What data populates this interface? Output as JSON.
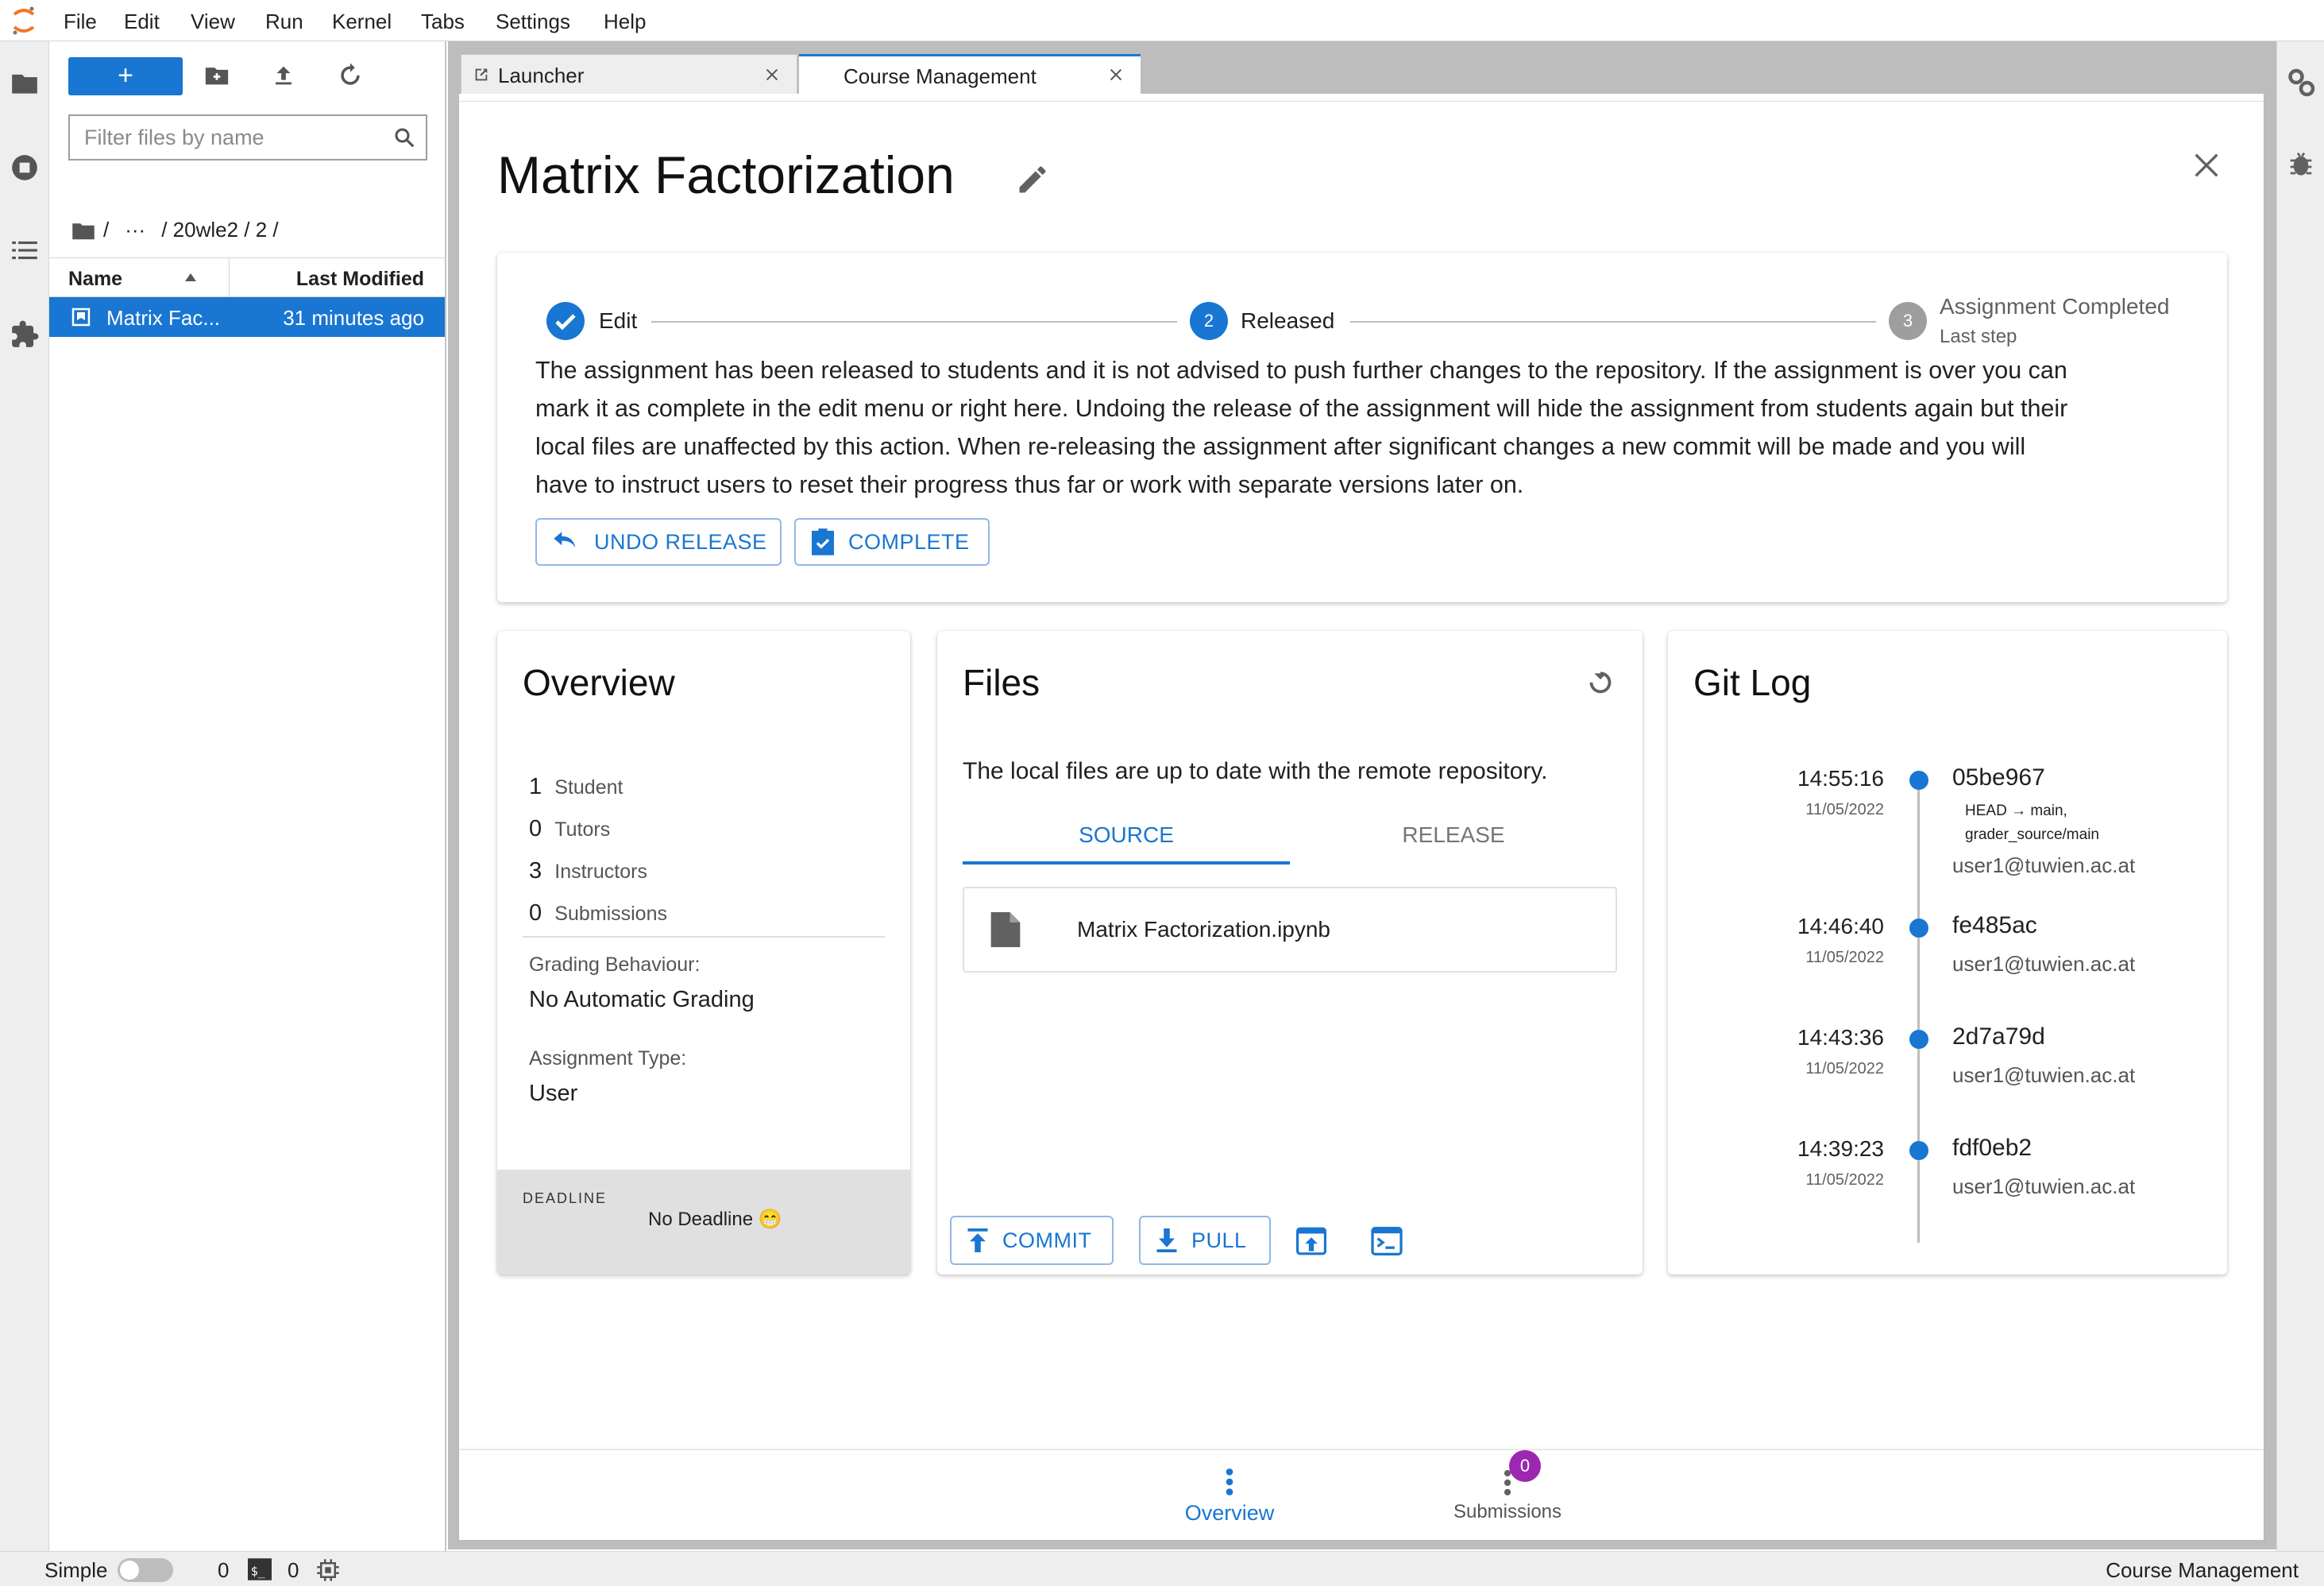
{
  "menu": [
    "File",
    "Edit",
    "View",
    "Run",
    "Kernel",
    "Tabs",
    "Settings",
    "Help"
  ],
  "filebrowser": {
    "new_label": "+",
    "filter_placeholder": "Filter files by name",
    "crumbs": {
      "root": "/",
      "ellipsis": "···",
      "path": "/ 20wle2 / 2 /"
    },
    "columns": {
      "name": "Name",
      "modified": "Last Modified"
    },
    "files": [
      {
        "name": "Matrix Fac...",
        "modified": "31 minutes ago"
      }
    ]
  },
  "tabs": [
    {
      "label": "Launcher",
      "active": false
    },
    {
      "label": "Course Management",
      "active": true
    }
  ],
  "assignment": {
    "title": "Matrix Factorization",
    "steps": [
      {
        "label": "Edit",
        "state": "done",
        "badge": ""
      },
      {
        "label": "Released",
        "state": "active",
        "badge": "2"
      },
      {
        "label": "Assignment Completed",
        "sublabel": "Last step",
        "state": "pending",
        "badge": "3"
      }
    ],
    "description": [
      "The assignment has been released to students and it is not advised to push further changes to the repository. If the assignment is over you can",
      "mark it as complete in the edit menu or right here. Undoing the release of the assignment will hide the assignment from students again but their",
      "local files are unaffected by this action. When re-releasing the assignment after significant changes a new commit will be made and you will",
      "have to instruct users to reset their progress thus far or work with separate versions later on."
    ],
    "undo_label": "UNDO RELEASE",
    "complete_label": "COMPLETE"
  },
  "overview": {
    "title": "Overview",
    "stats": [
      {
        "count": "1",
        "label": "Student"
      },
      {
        "count": "0",
        "label": "Tutors"
      },
      {
        "count": "3",
        "label": "Instructors"
      },
      {
        "count": "0",
        "label": "Submissions"
      }
    ],
    "grading_label": "Grading Behaviour:",
    "grading_value": "No Automatic Grading",
    "type_label": "Assignment Type:",
    "type_value": "User",
    "deadline_label": "DEADLINE",
    "deadline_value": "No Deadline 😁"
  },
  "files": {
    "title": "Files",
    "status": "The local files are up to date with the remote repository.",
    "tabs": [
      "SOURCE",
      "RELEASE"
    ],
    "items": [
      "Matrix Factorization.ipynb"
    ],
    "commit_label": "COMMIT",
    "pull_label": "PULL"
  },
  "gitlog": {
    "title": "Git Log",
    "entries": [
      {
        "time": "14:55:16",
        "date": "11/05/2022",
        "hash": "05be967",
        "refs": "HEAD → main,",
        "refs2": "grader_source/main",
        "author": "user1@tuwien.ac.at"
      },
      {
        "time": "14:46:40",
        "date": "11/05/2022",
        "hash": "fe485ac",
        "refs": "",
        "refs2": "",
        "author": "user1@tuwien.ac.at"
      },
      {
        "time": "14:43:36",
        "date": "11/05/2022",
        "hash": "2d7a79d",
        "refs": "",
        "refs2": "",
        "author": "user1@tuwien.ac.at"
      },
      {
        "time": "14:39:23",
        "date": "11/05/2022",
        "hash": "fdf0eb2",
        "refs": "",
        "refs2": "",
        "author": "user1@tuwien.ac.at"
      }
    ]
  },
  "bottomnav": {
    "overview": "Overview",
    "submissions": "Submissions",
    "submissions_badge": "0"
  },
  "statusbar": {
    "mode": "Simple",
    "terminals": "0",
    "kernels": "0",
    "current": "Course Management"
  },
  "colors": {
    "accent": "#1976d2",
    "badge": "#9c27b0"
  }
}
